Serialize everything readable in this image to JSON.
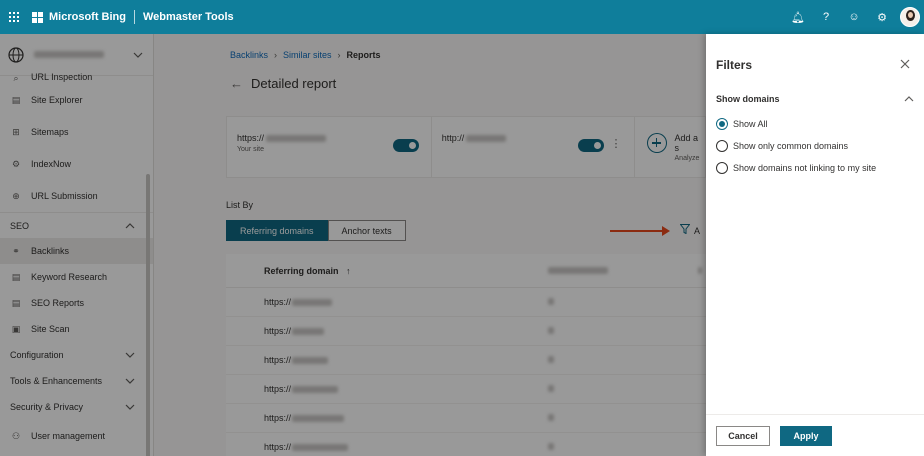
{
  "header": {
    "brand": "Microsoft Bing",
    "product": "Webmaster Tools"
  },
  "sidebar": {
    "partial_item": "URL Inspection",
    "items": [
      {
        "label": "Site Explorer",
        "icon": "document-icon"
      },
      {
        "label": "Sitemaps",
        "icon": "sitemap-icon"
      },
      {
        "label": "IndexNow",
        "icon": "gear-icon"
      },
      {
        "label": "URL Submission",
        "icon": "globe-icon"
      }
    ],
    "seo_section": "SEO",
    "seo_items": [
      {
        "label": "Backlinks",
        "icon": "link-icon",
        "active": true
      },
      {
        "label": "Keyword Research",
        "icon": "document-icon"
      },
      {
        "label": "SEO Reports",
        "icon": "document-icon"
      },
      {
        "label": "Site Scan",
        "icon": "scan-icon"
      }
    ],
    "sections": [
      "Configuration",
      "Tools & Enhancements",
      "Security & Privacy"
    ],
    "user_management": "User management"
  },
  "breadcrumb": {
    "items": [
      "Backlinks",
      "Similar sites"
    ],
    "current": "Reports"
  },
  "page": {
    "title": "Detailed report"
  },
  "compare": {
    "site1_prefix": "https://",
    "site1_sub": "Your site",
    "site2_prefix": "http://",
    "add_label": "Add a s",
    "add_sub": "Analyze"
  },
  "list_by": {
    "label": "List By",
    "tabs": [
      "Referring domains",
      "Anchor texts"
    ],
    "active": 0
  },
  "filter_label": "A",
  "table": {
    "col1_header": "Referring domain",
    "sort_glyph": "↑",
    "rows": [
      "https://",
      "https://",
      "https://",
      "https://",
      "https://",
      "https://"
    ]
  },
  "filters_panel": {
    "title": "Filters",
    "section": "Show domains",
    "options": [
      "Show All",
      "Show only common domains",
      "Show domains not linking to my site"
    ],
    "selected": 0,
    "cancel": "Cancel",
    "apply": "Apply"
  },
  "colors": {
    "topbar": "#0f7e9b",
    "accent": "#0f6882",
    "arrow": "#e8491d"
  }
}
